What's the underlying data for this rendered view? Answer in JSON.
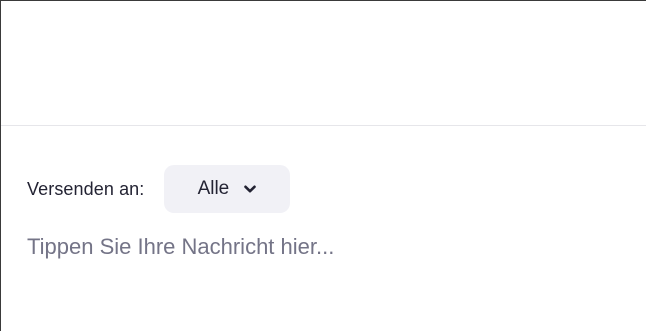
{
  "compose": {
    "send_to_label": "Versenden an:",
    "recipient": {
      "selected": "Alle",
      "icon": "chevron-down-icon"
    },
    "message_placeholder": "Tippen Sie Ihre Nachricht hier...",
    "message_value": ""
  },
  "colors": {
    "text_primary": "#232333",
    "placeholder": "#747487",
    "select_background": "#f1f1f6",
    "divider": "#e6e6ea"
  }
}
